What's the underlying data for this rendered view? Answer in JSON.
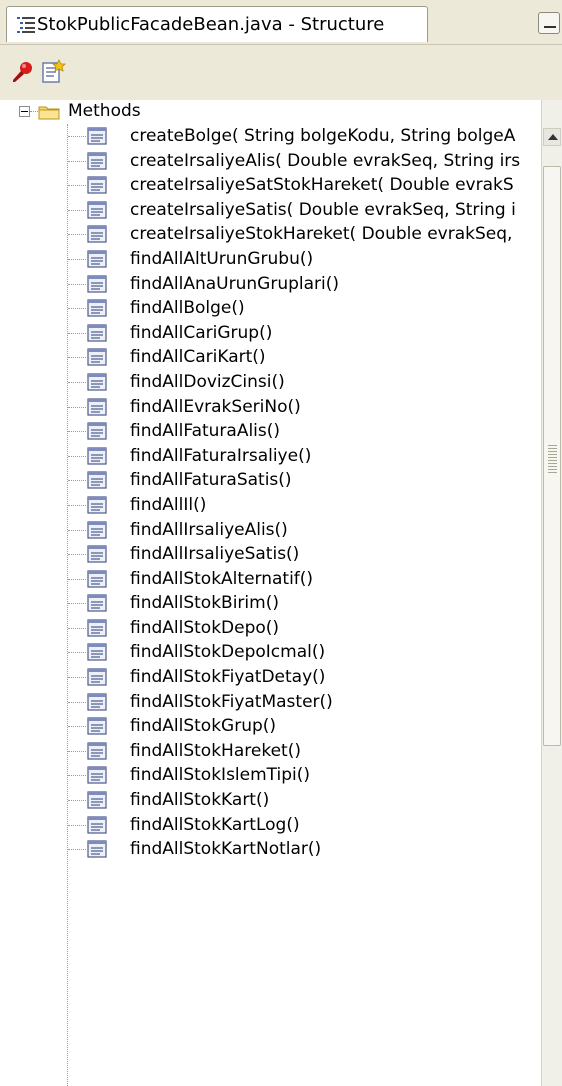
{
  "tab": {
    "title": "StokPublicFacadeBean.java - Structure"
  },
  "tree": {
    "root_label": "Methods",
    "methods": [
      "createBolge( String bolgeKodu, String bolgeA",
      "createIrsaliyeAlis( Double evrakSeq, String irs",
      "createIrsaliyeSatStokHareket( Double evrakS",
      "createIrsaliyeSatis( Double evrakSeq, String i",
      "createIrsaliyeStokHareket( Double evrakSeq,",
      "findAllAltUrunGrubu()",
      "findAllAnaUrunGruplari()",
      "findAllBolge()",
      "findAllCariGrup()",
      "findAllCariKart()",
      "findAllDovizCinsi()",
      "findAllEvrakSeriNo()",
      "findAllFaturaAlis()",
      "findAllFaturaIrsaliye()",
      "findAllFaturaSatis()",
      "findAllIl()",
      "findAllIrsaliyeAlis()",
      "findAllIrsaliyeSatis()",
      "findAllStokAlternatif()",
      "findAllStokBirim()",
      "findAllStokDepo()",
      "findAllStokDepoIcmal()",
      "findAllStokFiyatDetay()",
      "findAllStokFiyatMaster()",
      "findAllStokGrup()",
      "findAllStokHareket()",
      "findAllStokIslemTipi()",
      "findAllStokKart()",
      "findAllStokKartLog()",
      "findAllStokKartNotlar()"
    ]
  },
  "icons": {
    "tab": "structure-icon",
    "toolbar": [
      "pin-icon",
      "properties-icon"
    ],
    "folder": "folder-icon",
    "method": "method-icon"
  },
  "colors": {
    "background": "#ece9d8",
    "pin": "#d81b1b",
    "folder": "#f6d86b"
  }
}
